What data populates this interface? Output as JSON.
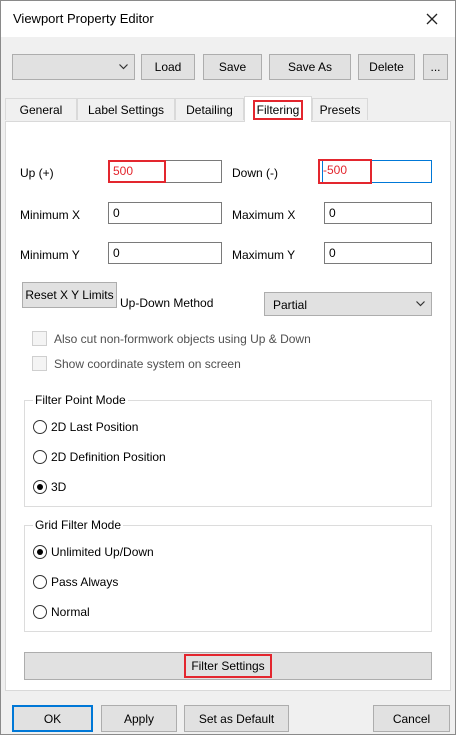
{
  "window": {
    "title": "Viewport Property Editor"
  },
  "toolbar": {
    "preset_select_value": "",
    "load_label": "Load",
    "save_label": "Save",
    "save_as_label": "Save As",
    "delete_label": "Delete",
    "more_label": "..."
  },
  "tabs": [
    {
      "label": "General"
    },
    {
      "label": "Label Settings"
    },
    {
      "label": "Detailing"
    },
    {
      "label": "Filtering",
      "active": true
    },
    {
      "label": "Presets"
    }
  ],
  "filtering": {
    "up_label": "Up (+)",
    "up_value": "500",
    "down_label": "Down (-)",
    "down_value": "-500",
    "min_x_label": "Minimum X",
    "min_x_value": "0",
    "max_x_label": "Maximum X",
    "max_x_value": "0",
    "min_y_label": "Minimum Y",
    "min_y_value": "0",
    "max_y_label": "Maximum Y",
    "max_y_value": "0",
    "reset_button": "Reset X Y Limits",
    "method_label": "Up-Down Method",
    "method_value": "Partial",
    "cut_checkbox": "Also cut non-formwork objects using Up & Down",
    "coord_checkbox": "Show coordinate system on screen",
    "filter_point_mode": {
      "title": "Filter Point Mode",
      "options": [
        "2D Last Position",
        "2D Definition Position",
        "3D"
      ],
      "selected": "3D"
    },
    "grid_filter_mode": {
      "title": "Grid Filter Mode",
      "options": [
        "Unlimited Up/Down",
        "Pass Always",
        "Normal"
      ],
      "selected": "Unlimited Up/Down"
    },
    "filter_settings_button": "Filter Settings"
  },
  "footer": {
    "ok_label": "OK",
    "apply_label": "Apply",
    "default_label": "Set as Default",
    "cancel_label": "Cancel"
  },
  "colors": {
    "highlight": "#e3262e",
    "focus": "#0078d7"
  }
}
